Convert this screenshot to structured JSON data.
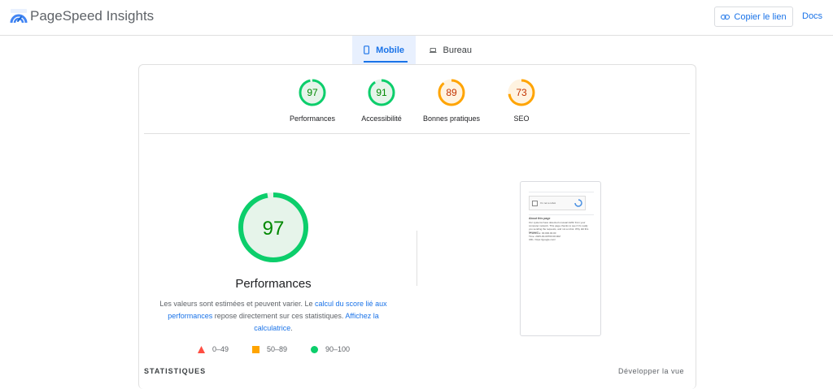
{
  "header": {
    "title": "PageSpeed Insights",
    "copy_link_label": "Copier le lien",
    "docs_label": "Docs"
  },
  "tabs": [
    {
      "label": "Mobile",
      "selected": true
    },
    {
      "label": "Bureau",
      "selected": false
    }
  ],
  "categories": [
    {
      "score": "97",
      "label": "Performances",
      "status": "pass"
    },
    {
      "score": "91",
      "label": "Accessibilité",
      "status": "pass"
    },
    {
      "score": "89",
      "label": "Bonnes pratiques",
      "status": "average"
    },
    {
      "score": "73",
      "label": "SEO",
      "status": "average"
    }
  ],
  "performance": {
    "score": "97",
    "score_fraction": 0.97,
    "title": "Performances",
    "desc_1": "Les valeurs sont estimées et peuvent varier. Le ",
    "link_1": "calcul du score lié aux performances",
    "desc_2": " repose directement sur ces statistiques. ",
    "link_2": "Affichez la calculatrice",
    "desc_3": "."
  },
  "legend": [
    {
      "range": "0–49",
      "shape": "triangle"
    },
    {
      "range": "50–89",
      "shape": "square"
    },
    {
      "range": "90–100",
      "shape": "circle"
    }
  ],
  "screenshot": {
    "checkbox_label": "I'm not a robot",
    "heading": "About this page",
    "body": "Our systems have detected unusual traffic from your computer network. This page checks to see if it's really you sending the requests, and not a robot. Why did this happen?",
    "ip_line": "IP address: 00.000.00.00",
    "time_line": "Time: 2025-00-00T00:00:00Z",
    "url_line": "URL: https://google.com/"
  },
  "footer": {
    "stats_label": "STATISTIQUES",
    "expand_label": "Développer la vue"
  },
  "colors": {
    "pass": "#0cce6b",
    "pass_text": "#008800",
    "pass_fill": "#e6f4ea",
    "average": "#ffa400",
    "average_text": "#c33300",
    "average_fill": "#fff3e0",
    "fail": "#ff4e42",
    "accent": "#1a73e8"
  }
}
